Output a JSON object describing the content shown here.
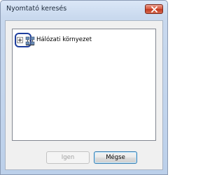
{
  "window": {
    "title": "Nyomtató keresés"
  },
  "tree": {
    "items": [
      {
        "label": "Hálózati környezet",
        "icon": "network-icon",
        "expander": "plus"
      }
    ]
  },
  "buttons": {
    "ok_label": "Igen",
    "cancel_label": "Mégse"
  },
  "colors": {
    "close_button": "#c23a1f",
    "focus_ring": "#1f3f9e",
    "default_button_border": "#3c7fb1"
  }
}
